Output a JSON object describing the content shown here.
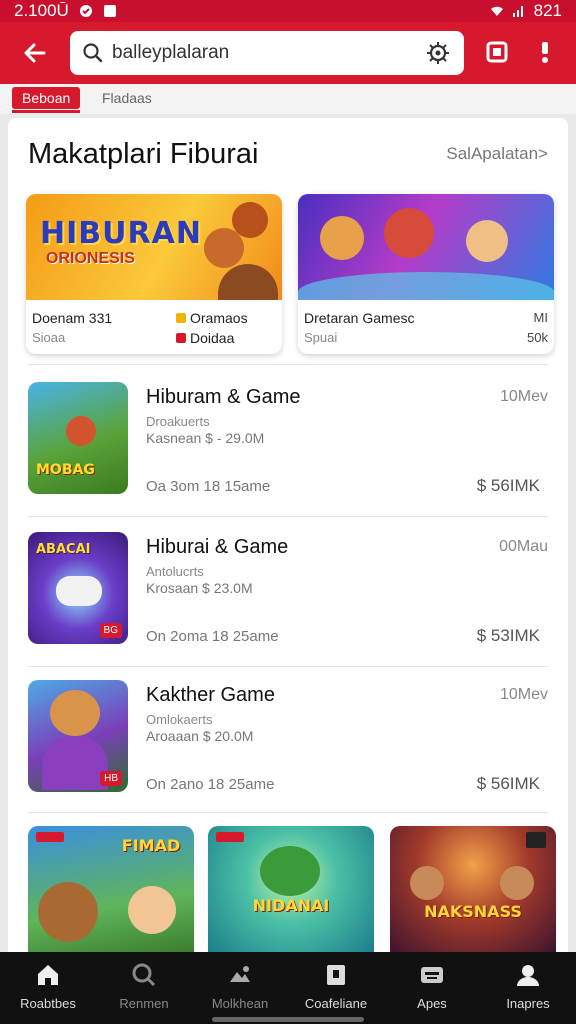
{
  "status_bar": {
    "time_left": "2.100Ū",
    "time_right": "821"
  },
  "app_bar": {
    "search_value": "balleyplalaran"
  },
  "tabs": {
    "active": "Beboan",
    "inactive": "Fladaas"
  },
  "section": {
    "title": "Makatplari Fiburai",
    "link": "SalApalatan>"
  },
  "featured": [
    {
      "banner": "HIBURAN",
      "banner_sub": "ORIONESIS",
      "name": "Doenam 331",
      "sub": "Sioaa",
      "tag1": "Oramaos",
      "tag2": "Doidaa",
      "tag1_color": "#f0b400",
      "tag2_color": "#d6192d"
    },
    {
      "name": "Dretaran Gamesc",
      "sub": "Spuai",
      "right1": "MI",
      "right2": "50k"
    }
  ],
  "apps": [
    {
      "title": "Hiburam & Game",
      "size": "10Mev",
      "line1": "Droakuerts",
      "line2": "Kasnean $ - 29.0M",
      "meta": "Oa 3om 18 15ame",
      "price": "$ 56IMK",
      "thumb_label": "MOBAG",
      "thumb_top": ""
    },
    {
      "title": "Hiburai & Game",
      "size": "00Mau",
      "line1": "Antolucrts",
      "line2": "Krosaan $ 23.0M",
      "meta": "On 2oma 18 25ame",
      "price": "$ 53IMK",
      "thumb_label": "",
      "thumb_top": "ABACAI",
      "badge": "BG"
    },
    {
      "title": "Kakther Game",
      "size": "10Mev",
      "line1": "Omlokaerts",
      "line2": "Aroaaan $ 20.0M",
      "meta": "On 2ano 18 25ame",
      "price": "$ 56IMK",
      "thumb_label": "",
      "thumb_top": "",
      "badge": "HB"
    }
  ],
  "tiles": [
    {
      "text": "FIMAD"
    },
    {
      "text": "NIDANAI"
    },
    {
      "text": "NAKSNASS"
    }
  ],
  "bottom_nav": [
    {
      "label": "Roabtbes",
      "icon": "home-icon"
    },
    {
      "label": "Renmen",
      "icon": "search-icon"
    },
    {
      "label": "Molkhean",
      "icon": "category-icon"
    },
    {
      "label": "Coafeliane",
      "icon": "card-icon"
    },
    {
      "label": "Apes",
      "icon": "keyboard-icon"
    },
    {
      "label": "Inapres",
      "icon": "person-icon"
    }
  ],
  "colors": {
    "brand": "#d6192d",
    "nav_bg": "#111111"
  }
}
